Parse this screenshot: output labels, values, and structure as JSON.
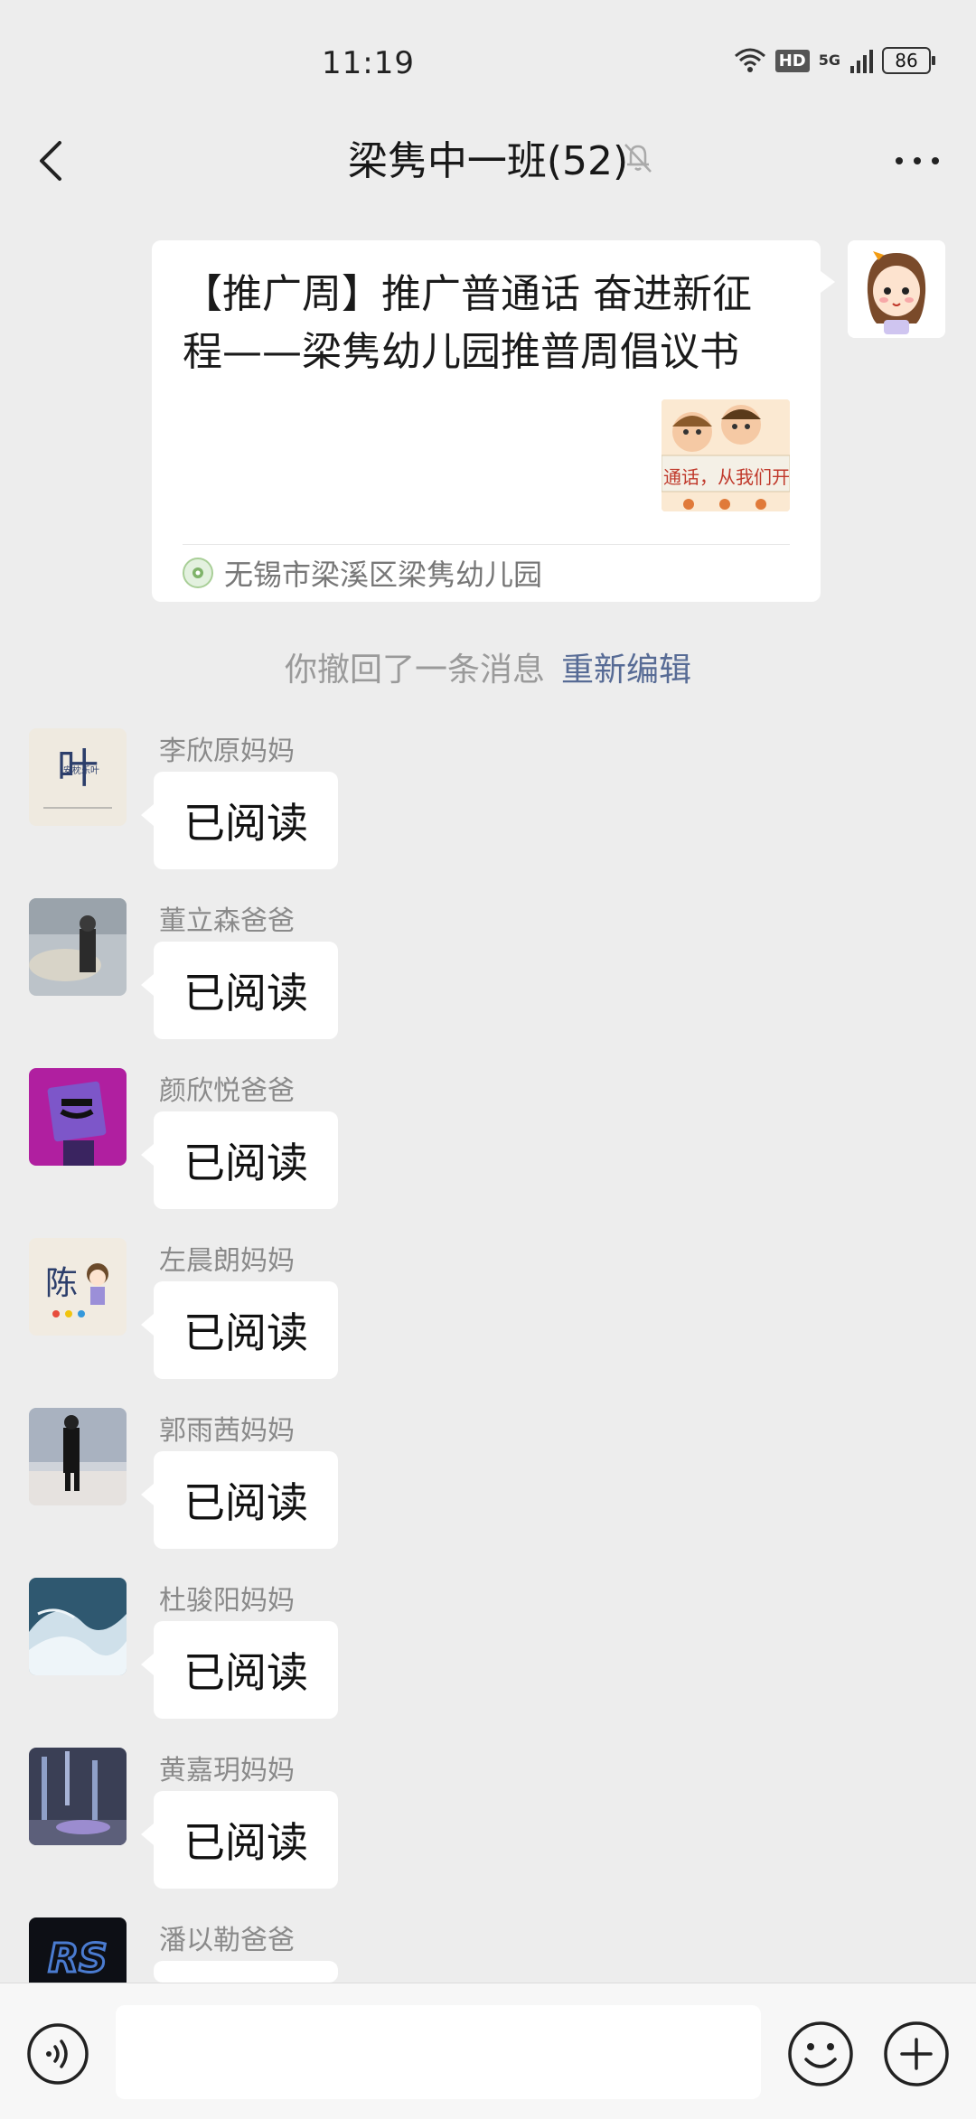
{
  "status_bar": {
    "time": "11:19",
    "hd": "HD",
    "network": "5G",
    "battery": "86",
    "icons": [
      "wifi-icon",
      "signal-icon",
      "battery-icon"
    ]
  },
  "header": {
    "title": "梁隽中一班(52)",
    "icons": [
      "back-arrow-icon",
      "mute-bell-icon",
      "more-dots-icon"
    ]
  },
  "shared_card": {
    "title": "【推广周】推广普通话 奋进新征程——梁隽幼儿园推普周倡议书",
    "thumb_text": "通话，从我们开",
    "source": "无锡市梁溪区梁隽幼儿园"
  },
  "recall_notice": {
    "text": "你撤回了一条消息",
    "action": "重新编辑"
  },
  "messages": [
    {
      "sender": "李欣原妈妈",
      "text": "已阅读"
    },
    {
      "sender": "董立森爸爸",
      "text": "已阅读"
    },
    {
      "sender": "颜欣悦爸爸",
      "text": "已阅读"
    },
    {
      "sender": "左晨朗妈妈",
      "text": "已阅读"
    },
    {
      "sender": "郭雨茜妈妈",
      "text": "已阅读"
    },
    {
      "sender": "杜骏阳妈妈",
      "text": "已阅读"
    },
    {
      "sender": "黄嘉玥妈妈",
      "text": "已阅读"
    },
    {
      "sender": "潘以勒爸爸",
      "text": ""
    }
  ],
  "avatar_labels": {
    "avatar_1_main": "叶",
    "avatar_1_sub": "安枕乐叶",
    "avatar_4_char": "陈",
    "avatar_8_text": "RS"
  },
  "input_bar": {
    "placeholder": "",
    "icons": [
      "voice-icon",
      "emoji-icon",
      "plus-icon"
    ]
  },
  "colors": {
    "background": "#ededed",
    "link": "#576b95",
    "bubble": "#ffffff"
  }
}
